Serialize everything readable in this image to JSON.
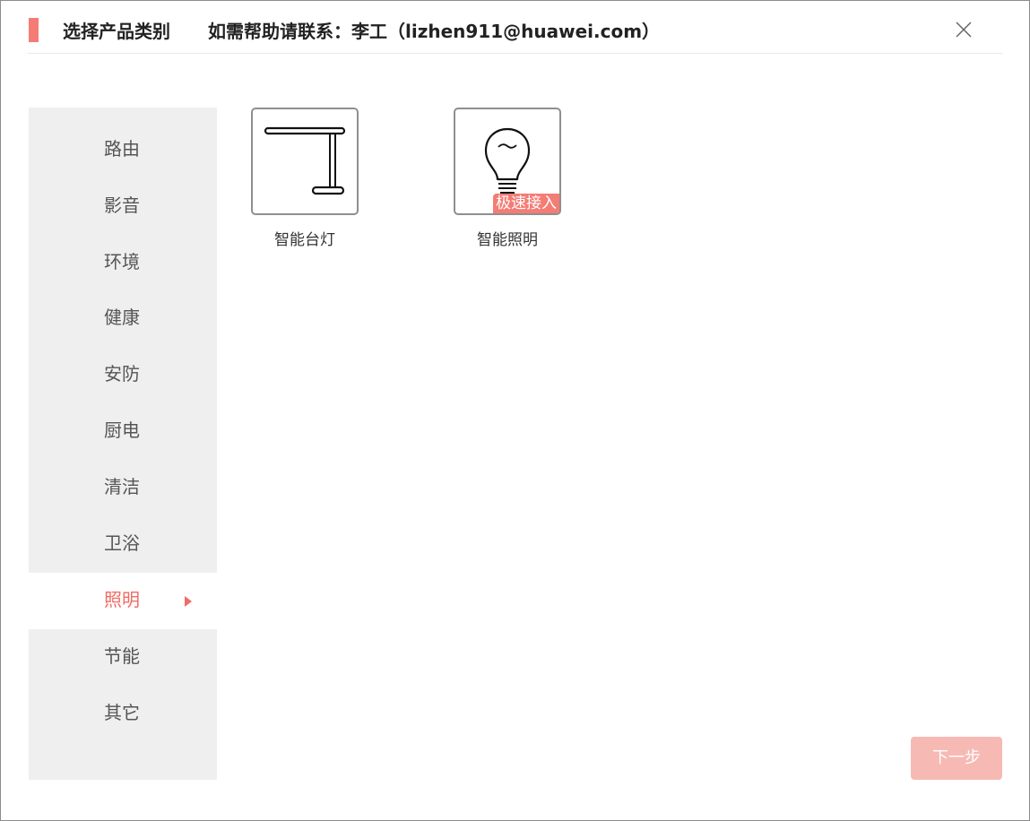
{
  "header": {
    "title": "选择产品类别",
    "help_text": "如需帮助请联系：李工（lizhen911@huawei.com）"
  },
  "colors": {
    "accent": "#f47c74",
    "active_text": "#f06c64",
    "sidebar_bg": "#efefef",
    "next_button_bg": "#f7b9b4"
  },
  "sidebar": {
    "items": [
      {
        "label": "路由"
      },
      {
        "label": "影音"
      },
      {
        "label": "环境"
      },
      {
        "label": "健康"
      },
      {
        "label": "安防"
      },
      {
        "label": "厨电"
      },
      {
        "label": "清洁"
      },
      {
        "label": "卫浴"
      },
      {
        "label": "照明",
        "active": true
      },
      {
        "label": "节能"
      },
      {
        "label": "其它"
      }
    ]
  },
  "products": [
    {
      "label": "智能台灯",
      "icon": "desk-lamp-icon"
    },
    {
      "label": "智能照明",
      "icon": "light-bulb-icon",
      "badge": "极速接入"
    }
  ],
  "footer": {
    "next_label": "下一步"
  }
}
